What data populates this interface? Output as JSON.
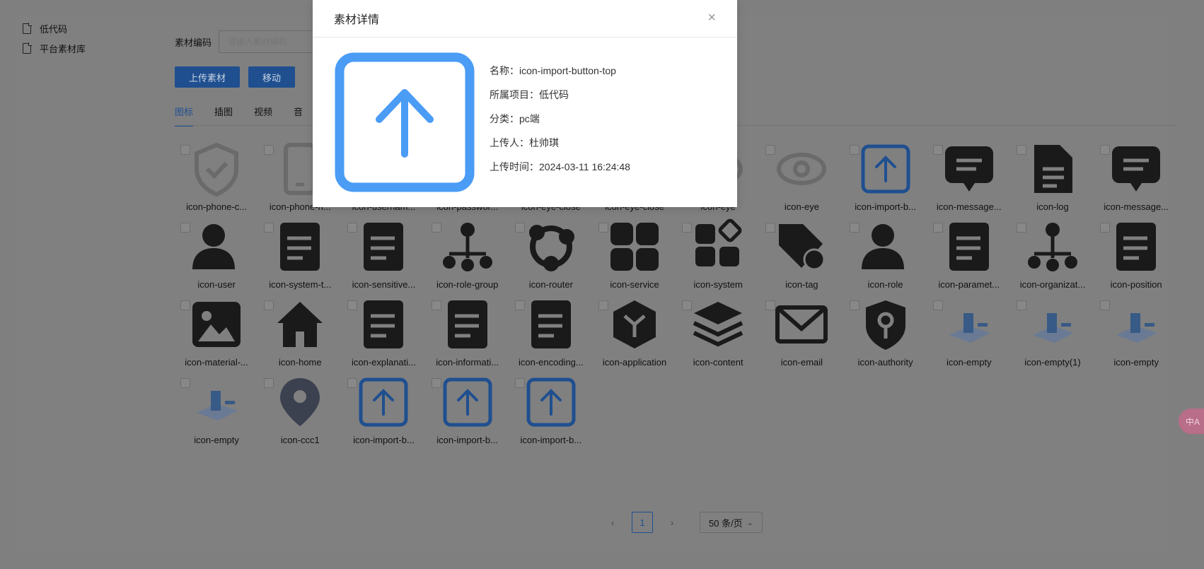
{
  "sidebar": {
    "items": [
      {
        "label": "低代码"
      },
      {
        "label": "平台素材库"
      }
    ]
  },
  "filter": {
    "label": "素材编码",
    "placeholder": "请输入素材编码"
  },
  "toolbar": {
    "upload_label": "上传素材",
    "move_label": "移动"
  },
  "tabs": [
    {
      "label": "图标"
    },
    {
      "label": "插图"
    },
    {
      "label": "视频"
    },
    {
      "label": "音"
    }
  ],
  "icons": [
    {
      "label": "icon-phone-c..."
    },
    {
      "label": "icon-phone-n..."
    },
    {
      "label": "icon-usernam..."
    },
    {
      "label": "icon-passwor..."
    },
    {
      "label": "icon-eye-close"
    },
    {
      "label": "icon-eye-close"
    },
    {
      "label": "icon-eye"
    },
    {
      "label": "icon-eye"
    },
    {
      "label": "icon-import-b..."
    },
    {
      "label": "icon-message..."
    },
    {
      "label": "icon-log"
    },
    {
      "label": "icon-message..."
    },
    {
      "label": "icon-user"
    },
    {
      "label": "icon-system-t..."
    },
    {
      "label": "icon-sensitive..."
    },
    {
      "label": "icon-role-group"
    },
    {
      "label": "icon-router"
    },
    {
      "label": "icon-service"
    },
    {
      "label": "icon-system"
    },
    {
      "label": "icon-tag"
    },
    {
      "label": "icon-role"
    },
    {
      "label": "icon-paramet..."
    },
    {
      "label": "icon-organizat..."
    },
    {
      "label": "icon-position"
    },
    {
      "label": "icon-material-..."
    },
    {
      "label": "icon-home"
    },
    {
      "label": "icon-explanati..."
    },
    {
      "label": "icon-informati..."
    },
    {
      "label": "icon-encoding..."
    },
    {
      "label": "icon-application"
    },
    {
      "label": "icon-content"
    },
    {
      "label": "icon-email"
    },
    {
      "label": "icon-authority"
    },
    {
      "label": "icon-empty"
    },
    {
      "label": "icon-empty(1)"
    },
    {
      "label": "icon-empty"
    },
    {
      "label": "icon-empty"
    },
    {
      "label": "icon-ccc1"
    },
    {
      "label": "icon-import-b..."
    },
    {
      "label": "icon-import-b..."
    },
    {
      "label": "icon-import-b..."
    }
  ],
  "pagination": {
    "prev": "‹",
    "page": "1",
    "next": "›",
    "page_size": "50 条/页"
  },
  "translate": {
    "label": "中A"
  },
  "modal": {
    "title": "素材详情",
    "close": "×",
    "name_label": "名称：",
    "name": "icon-import-button-top",
    "project_label": "所属项目：",
    "project": "低代码",
    "category_label": "分类：",
    "category": "pc端",
    "uploader_label": "上传人：",
    "uploader": "杜帅琪",
    "time_label": "上传时间：",
    "time": "2024-03-11 16:24:48"
  },
  "colors": {
    "accent": "#1f4f8f",
    "import_icon": "#4a9cf5",
    "overlay": "#808080"
  }
}
